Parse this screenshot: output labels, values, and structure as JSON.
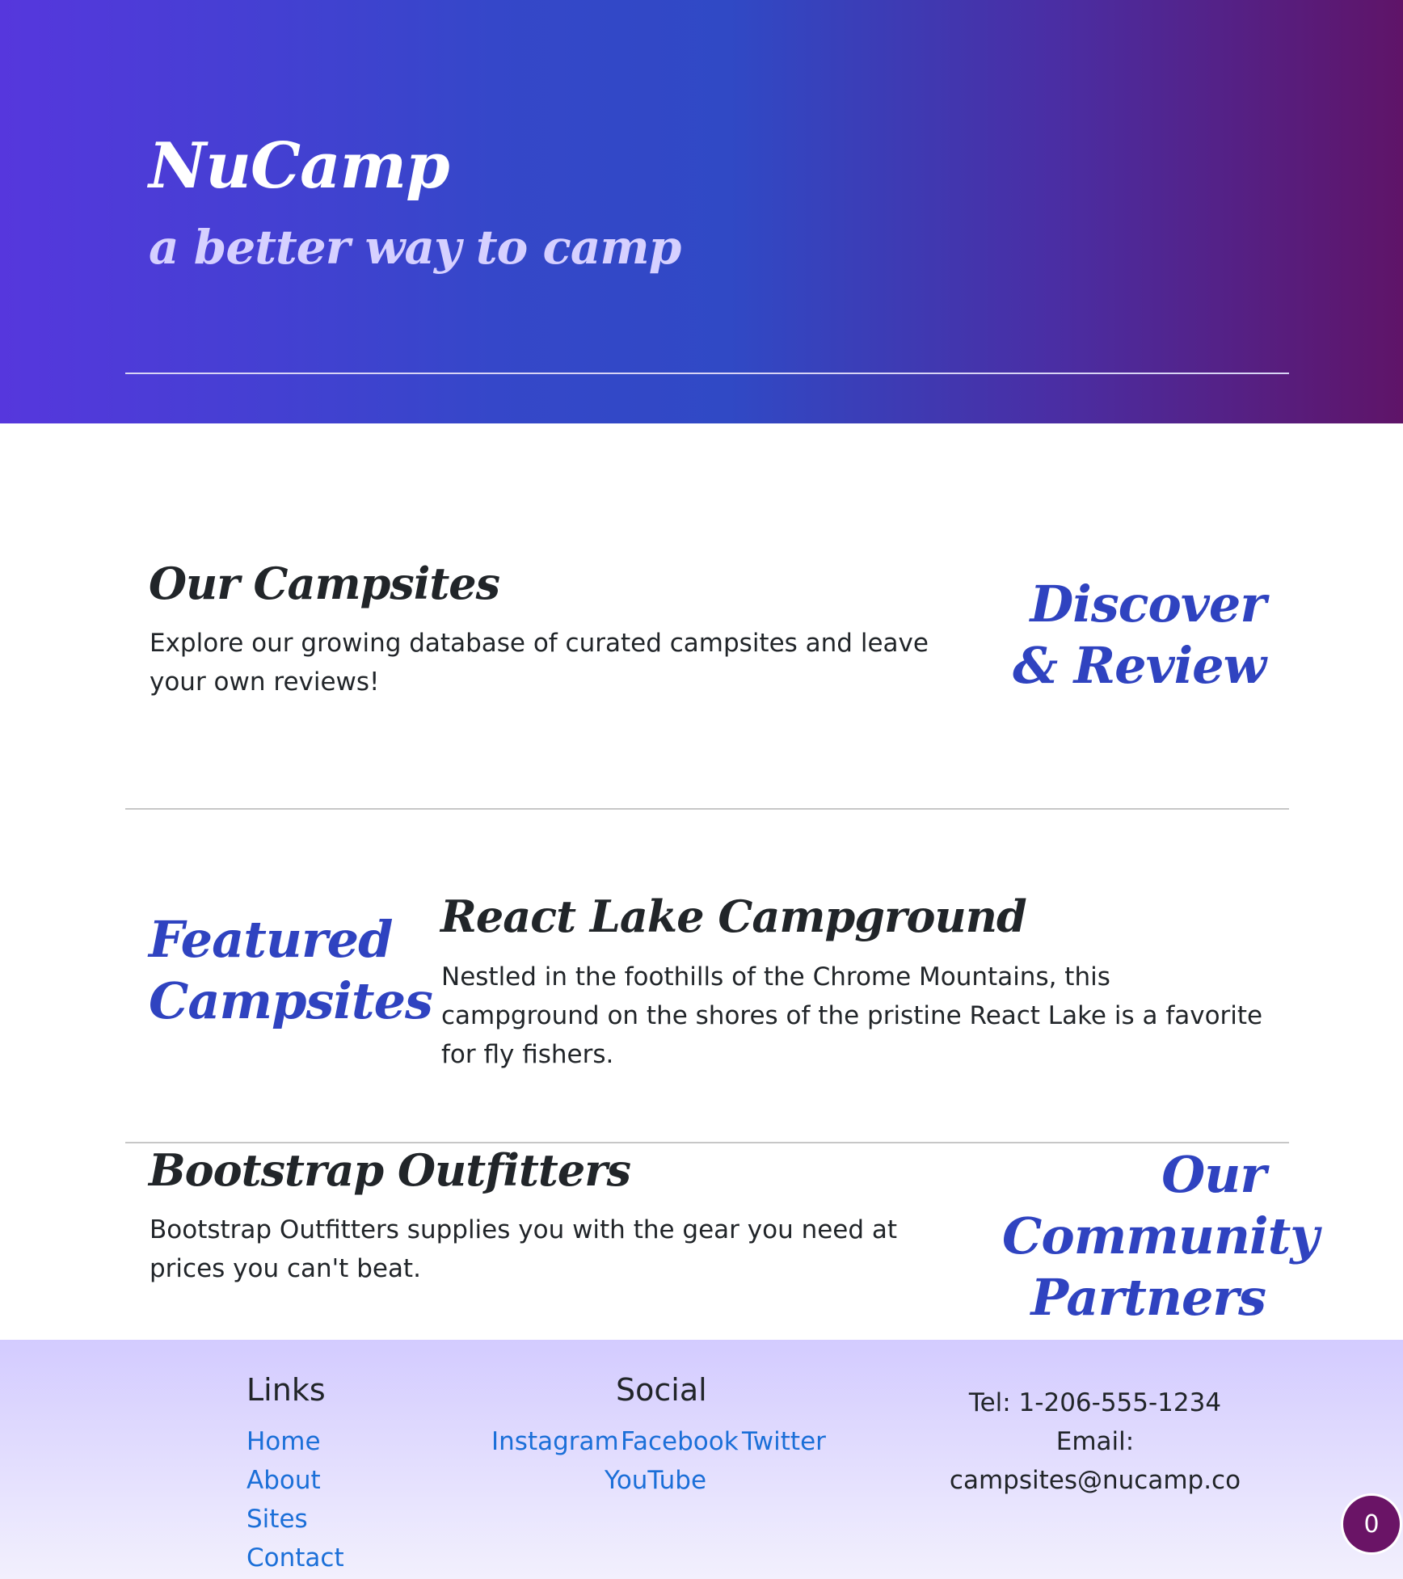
{
  "header": {
    "brand": "NuCamp",
    "tagline": "a better way to camp"
  },
  "campsites": {
    "title": "Our Campsites",
    "text": "Explore our growing database of curated campsites and leave your own reviews!",
    "accent": "Discover & Review"
  },
  "featured": {
    "accent": "Featured Campsites",
    "title": "React Lake Campground",
    "text": "Nestled in the foothills of the Chrome Mountains, this campground on the shores of the pristine React Lake is a favorite for fly fishers."
  },
  "partners": {
    "title": "Bootstrap Outfitters",
    "text": "Bootstrap Outfitters supplies you with the gear you need at prices you can't beat.",
    "accent": "Our Community Partners"
  },
  "footer": {
    "links_heading": "Links",
    "links": [
      "Home",
      "About",
      "Sites",
      "Contact"
    ],
    "social_heading": "Social",
    "social": [
      "Instagram",
      "Facebook",
      "Twitter",
      "YouTube"
    ],
    "tel": "Tel: 1-206-555-1234",
    "email_label": "Email:",
    "email": "campsites@nucamp.co"
  },
  "badge": {
    "count": "0"
  },
  "colors": {
    "accent": "#2f43c0",
    "link": "#1b6fd8",
    "badge": "#6a1466",
    "header_start": "#5637dd",
    "header_end": "#5f1468"
  }
}
